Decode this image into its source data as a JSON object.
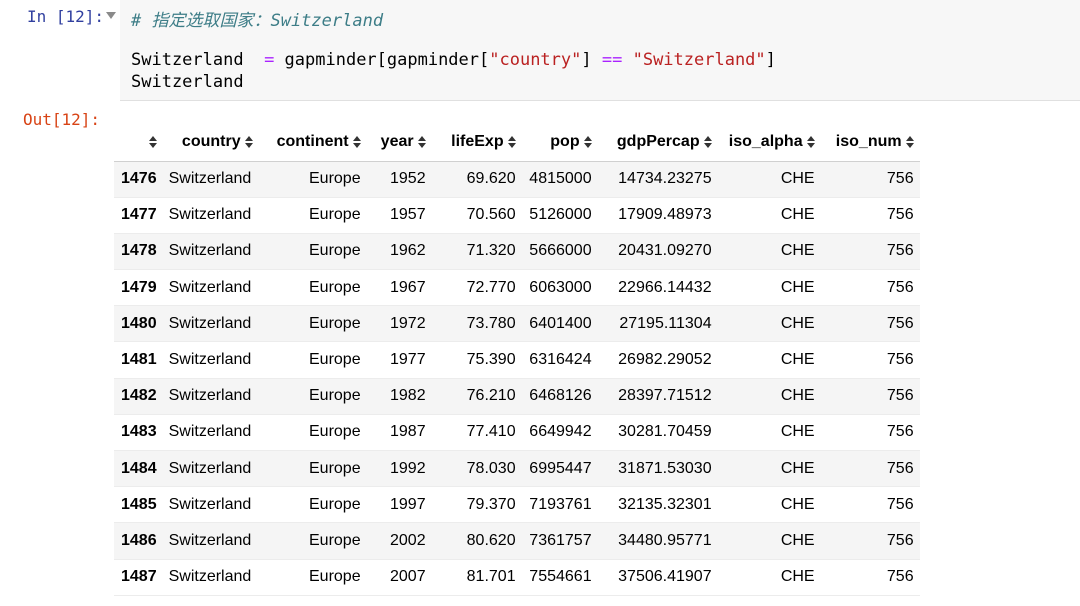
{
  "input_cell": {
    "prompt": "In [12]:",
    "code_lines": [
      [
        {
          "t": "comment",
          "v": "# 指定选取国家：Switzerland"
        }
      ],
      [
        {
          "t": "plain",
          "v": "Switzerland  "
        },
        {
          "t": "op",
          "v": "="
        },
        {
          "t": "plain",
          "v": " gapminder[gapminder["
        },
        {
          "t": "str",
          "v": "\"country\""
        },
        {
          "t": "plain",
          "v": "] "
        },
        {
          "t": "op",
          "v": "=="
        },
        {
          "t": "plain",
          "v": " "
        },
        {
          "t": "str",
          "v": "\"Switzerland\""
        },
        {
          "t": "plain",
          "v": "]"
        }
      ],
      [
        {
          "t": "plain",
          "v": "Switzerland"
        }
      ]
    ]
  },
  "output_cell": {
    "prompt": "Out[12]:",
    "table": {
      "index_header": "",
      "columns": [
        "country",
        "continent",
        "year",
        "lifeExp",
        "pop",
        "gdpPercap",
        "iso_alpha",
        "iso_num"
      ],
      "rows": [
        {
          "index": "1476",
          "cells": [
            "Switzerland",
            "Europe",
            "1952",
            "69.620",
            "4815000",
            "14734.23275",
            "CHE",
            "756"
          ]
        },
        {
          "index": "1477",
          "cells": [
            "Switzerland",
            "Europe",
            "1957",
            "70.560",
            "5126000",
            "17909.48973",
            "CHE",
            "756"
          ]
        },
        {
          "index": "1478",
          "cells": [
            "Switzerland",
            "Europe",
            "1962",
            "71.320",
            "5666000",
            "20431.09270",
            "CHE",
            "756"
          ]
        },
        {
          "index": "1479",
          "cells": [
            "Switzerland",
            "Europe",
            "1967",
            "72.770",
            "6063000",
            "22966.14432",
            "CHE",
            "756"
          ]
        },
        {
          "index": "1480",
          "cells": [
            "Switzerland",
            "Europe",
            "1972",
            "73.780",
            "6401400",
            "27195.11304",
            "CHE",
            "756"
          ]
        },
        {
          "index": "1481",
          "cells": [
            "Switzerland",
            "Europe",
            "1977",
            "75.390",
            "6316424",
            "26982.29052",
            "CHE",
            "756"
          ]
        },
        {
          "index": "1482",
          "cells": [
            "Switzerland",
            "Europe",
            "1982",
            "76.210",
            "6468126",
            "28397.71512",
            "CHE",
            "756"
          ]
        },
        {
          "index": "1483",
          "cells": [
            "Switzerland",
            "Europe",
            "1987",
            "77.410",
            "6649942",
            "30281.70459",
            "CHE",
            "756"
          ]
        },
        {
          "index": "1484",
          "cells": [
            "Switzerland",
            "Europe",
            "1992",
            "78.030",
            "6995447",
            "31871.53030",
            "CHE",
            "756"
          ]
        },
        {
          "index": "1485",
          "cells": [
            "Switzerland",
            "Europe",
            "1997",
            "79.370",
            "7193761",
            "32135.32301",
            "CHE",
            "756"
          ]
        },
        {
          "index": "1486",
          "cells": [
            "Switzerland",
            "Europe",
            "2002",
            "80.620",
            "7361757",
            "34480.95771",
            "CHE",
            "756"
          ]
        },
        {
          "index": "1487",
          "cells": [
            "Switzerland",
            "Europe",
            "2007",
            "81.701",
            "7554661",
            "37506.41907",
            "CHE",
            "756"
          ]
        }
      ]
    }
  },
  "colors": {
    "in_prompt": "#303f9f",
    "out_prompt": "#d84315",
    "comment": "#3d7d87",
    "operator": "#aa22ff",
    "string": "#ba2121"
  }
}
